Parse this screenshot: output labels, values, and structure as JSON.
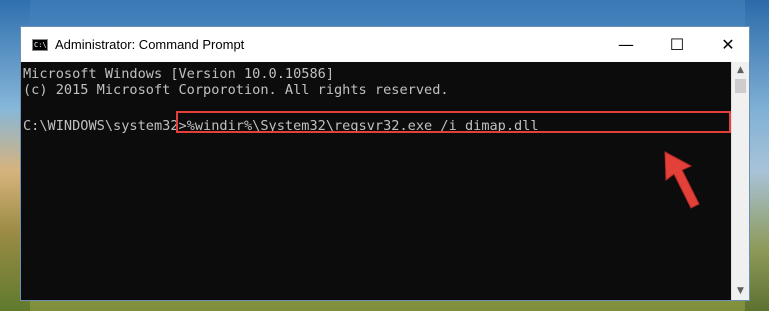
{
  "window": {
    "title": "Administrator: Command Prompt",
    "app_icon_text": "C:\\",
    "controls": {
      "minimize": "—",
      "maximize": "☐",
      "close": "✕"
    }
  },
  "console": {
    "lines": [
      "Microsoft Windows [Version 10.0.10586]",
      "(c) 2015 Microsoft Corporotion. All rights reserved."
    ],
    "prompt": "C:\\WINDOWS\\system32>",
    "command": "%windir%\\System32\\regsvr32.exe /i dimap.dll"
  },
  "colors": {
    "console_bg": "#0c0c0c",
    "console_text": "#c0c0c0",
    "highlight": "#e3403a",
    "arrow": "#e3403a"
  },
  "scrollbar": {
    "up_icon": "▲",
    "down_icon": "▼"
  }
}
